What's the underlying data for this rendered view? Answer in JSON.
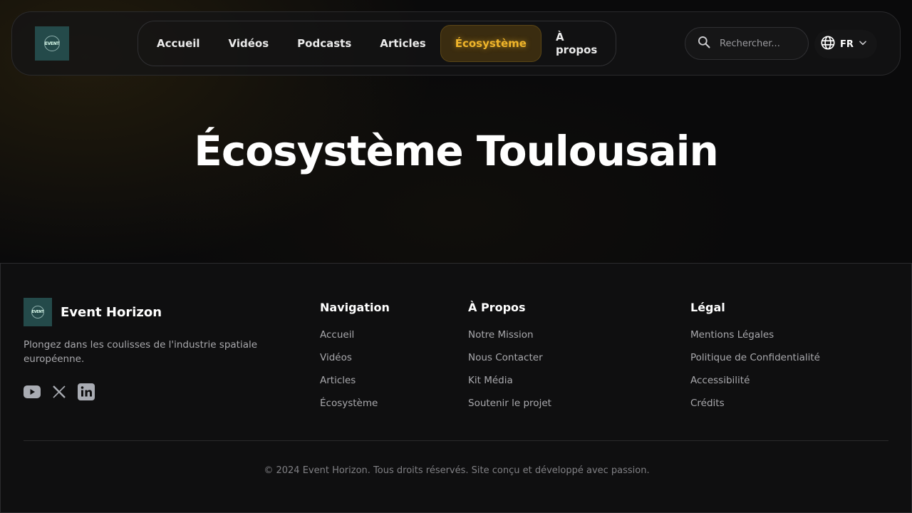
{
  "header": {
    "logo_text": "EVENT",
    "nav": [
      {
        "label": "Accueil"
      },
      {
        "label": "Vidéos"
      },
      {
        "label": "Podcasts"
      },
      {
        "label": "Articles"
      },
      {
        "label": "Écosystème",
        "active": true
      },
      {
        "label": "À propos"
      }
    ],
    "search_placeholder": "Rechercher...",
    "language": "FR",
    "accent_color": "#f0b52a"
  },
  "hero": {
    "title": "Écosystème Toulousain"
  },
  "footer": {
    "brand_name": "Event Horizon",
    "tagline": "Plongez dans les coulisses de l'industrie spatiale européenne.",
    "social_icons": [
      "youtube-icon",
      "x-icon",
      "linkedin-icon"
    ],
    "columns": [
      {
        "title": "Navigation",
        "links": [
          "Accueil",
          "Vidéos",
          "Articles",
          "Écosystème"
        ]
      },
      {
        "title": "À Propos",
        "links": [
          "Notre Mission",
          "Nous Contacter",
          "Kit Média",
          "Soutenir le projet"
        ]
      },
      {
        "title": "Légal",
        "links": [
          "Mentions Légales",
          "Politique de Confidentialité",
          "Accessibilité",
          "Crédits"
        ]
      }
    ],
    "copyright": "© 2024 Event Horizon. Tous droits réservés. Site conçu et développé avec passion."
  }
}
